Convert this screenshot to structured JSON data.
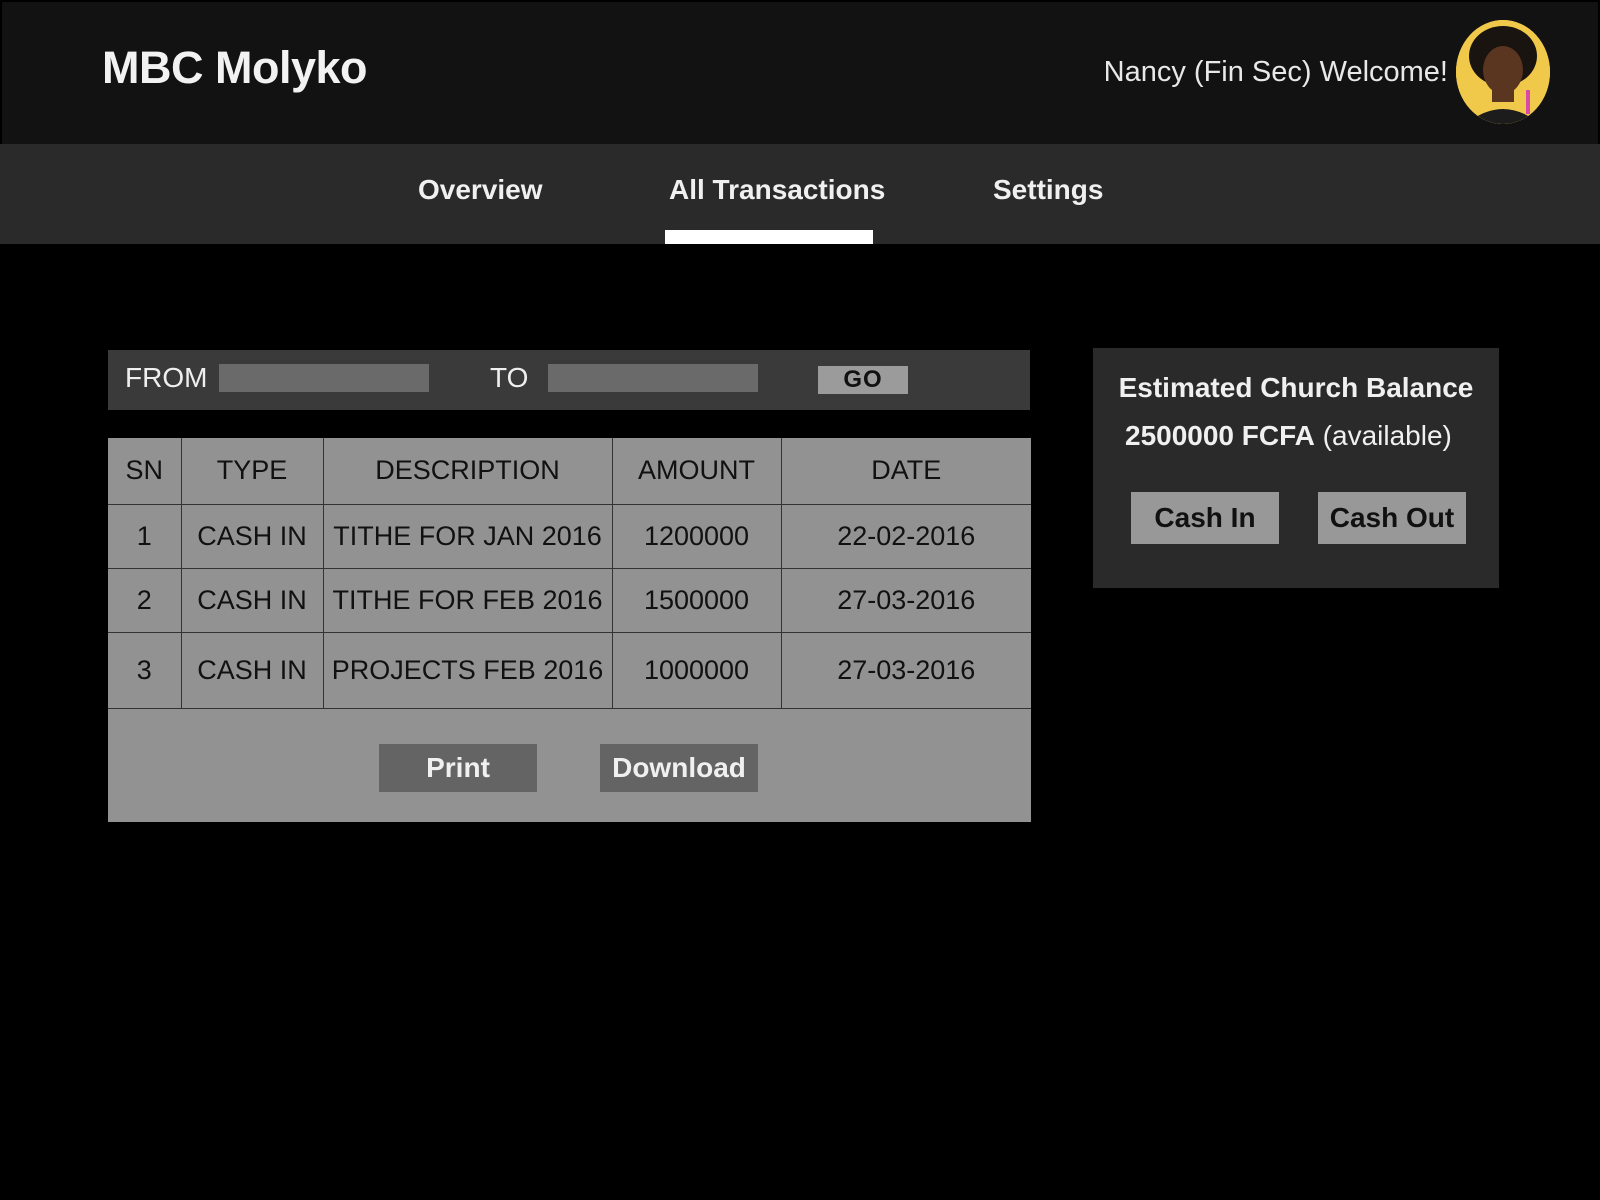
{
  "header": {
    "app_title": "MBC Molyko",
    "welcome_text": "Nancy (Fin Sec) Welcome!"
  },
  "nav": {
    "tabs": [
      {
        "label": "Overview",
        "active": false
      },
      {
        "label": "All Transactions",
        "active": true
      },
      {
        "label": "Settings",
        "active": false
      }
    ]
  },
  "filter": {
    "from_label": "FROM",
    "from_value": "",
    "to_label": "TO",
    "to_value": "",
    "go_label": "GO"
  },
  "table": {
    "columns": [
      "SN",
      "TYPE",
      "DESCRIPTION",
      "AMOUNT",
      "DATE"
    ],
    "rows": [
      {
        "sn": "1",
        "type": "CASH IN",
        "description": "TITHE FOR JAN 2016",
        "amount": "1200000",
        "date": "22-02-2016"
      },
      {
        "sn": "2",
        "type": "CASH IN",
        "description": "TITHE FOR FEB 2016",
        "amount": "1500000",
        "date": "27-03-2016"
      },
      {
        "sn": "3",
        "type": "CASH IN",
        "description": "PROJECTS FEB 2016",
        "amount": "1000000",
        "date": "27-03-2016"
      }
    ],
    "print_label": "Print",
    "download_label": "Download"
  },
  "balance": {
    "title": "Estimated Church Balance",
    "amount": "2500000 FCFA",
    "status": "(available)",
    "cash_in_label": "Cash In",
    "cash_out_label": "Cash Out"
  },
  "colors": {
    "background": "#000000",
    "header_bg": "#121212",
    "nav_bg": "#2a2a2a",
    "table_bg": "#929292",
    "button_dark": "#646464"
  }
}
